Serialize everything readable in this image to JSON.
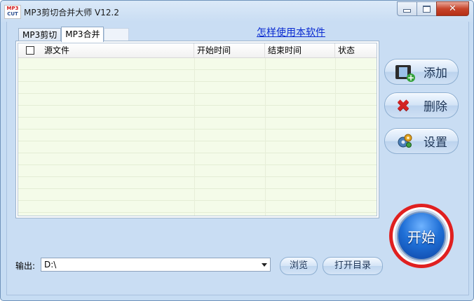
{
  "window": {
    "title": "MP3剪切合并大师 V12.2",
    "logo_line1": "MP3",
    "logo_line2": "CUT"
  },
  "tabs": [
    {
      "label": "MP3剪切",
      "active": false
    },
    {
      "label": "MP3合并",
      "active": true
    }
  ],
  "help_link": "怎样使用本软件",
  "file_list": {
    "columns": [
      "源文件",
      "开始时间",
      "结束时间",
      "状态"
    ],
    "rows": []
  },
  "side_buttons": {
    "add": "添加",
    "delete": "删除",
    "settings": "设置"
  },
  "start_button": "开始",
  "output": {
    "label": "输出:",
    "value": "D:\\",
    "browse": "浏览",
    "open_dir": "打开目录"
  },
  "icons": {
    "add": "film-add-icon",
    "delete": "red-x-icon",
    "settings": "gear-icon"
  },
  "colors": {
    "window_bg": "#c9ddf3",
    "grid_bg": "#f4fbe9",
    "link": "#0a2bd1",
    "start_ring": "#e02020",
    "start_button": "#1f6fd6"
  }
}
